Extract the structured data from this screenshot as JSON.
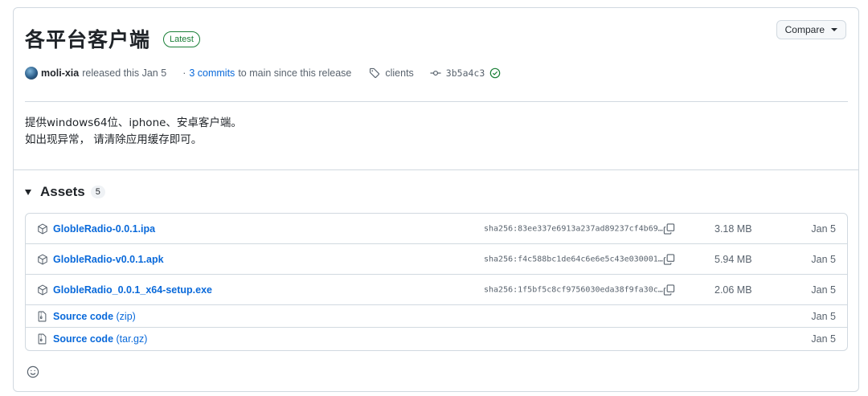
{
  "release": {
    "title": "各平台客户端",
    "badge": "Latest",
    "compare_label": "Compare"
  },
  "meta": {
    "author": "moli-xia",
    "released_text": "released this Jan 5",
    "separator": "·",
    "commits_link": "3 commits",
    "commits_suffix": "to main since this release",
    "tag": "clients",
    "commit_hash": "3b5a4c3"
  },
  "notes": {
    "line1": "提供windows64位、iphone、安卓客户端。",
    "line2": "如出现异常， 请清除应用缓存即可。"
  },
  "assets": {
    "title": "Assets",
    "count": "5",
    "items": [
      {
        "name": "GlobleRadio-0.0.1.ipa",
        "sha": "sha256:83ee337e6913a237ad89237cf4b69…",
        "size": "3.18 MB",
        "date": "Jan 5"
      },
      {
        "name": "GlobleRadio-v0.0.1.apk",
        "sha": "sha256:f4c588bc1de64c6e6e5c43e030001…",
        "size": "5.94 MB",
        "date": "Jan 5"
      },
      {
        "name": "GlobleRadio_0.0.1_x64-setup.exe",
        "sha": "sha256:1f5bf5c8cf9756030eda38f9fa30c…",
        "size": "2.06 MB",
        "date": "Jan 5"
      }
    ],
    "source": [
      {
        "name": "Source code",
        "ext": "(zip)",
        "date": "Jan 5"
      },
      {
        "name": "Source code",
        "ext": "(tar.gz)",
        "date": "Jan 5"
      }
    ]
  },
  "icons": {
    "package": "package-icon",
    "file_zip": "file-zip-icon",
    "copy": "copy-icon",
    "tag": "tag-icon",
    "commit": "git-commit-icon",
    "check": "check-circle-icon",
    "smiley": "smiley-icon"
  },
  "colors": {
    "link": "#0969da",
    "success": "#1a7f37",
    "muted": "#59636e",
    "border": "#d1d9e0"
  }
}
